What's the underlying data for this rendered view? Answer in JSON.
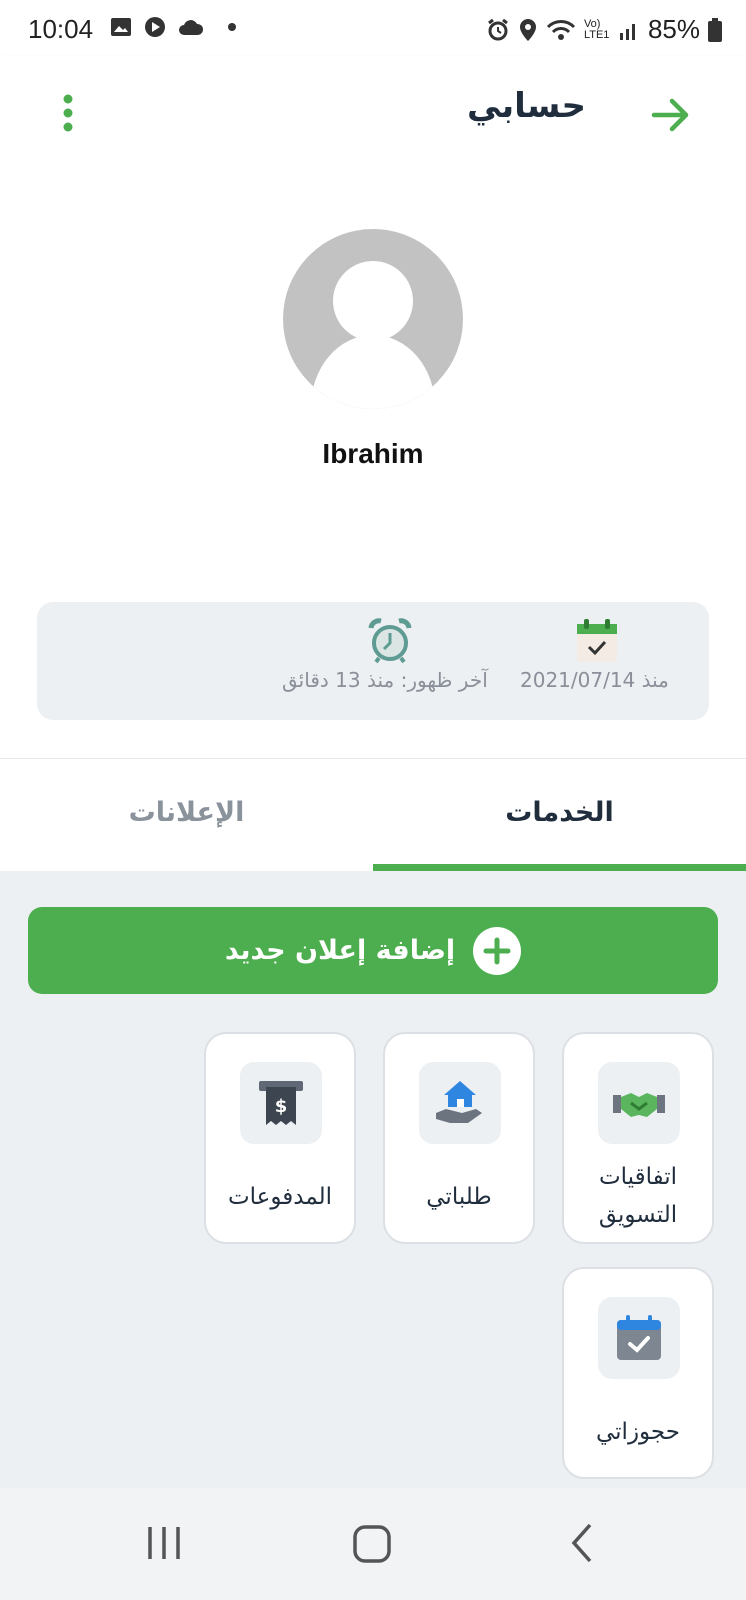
{
  "status_bar": {
    "time": "10:04",
    "battery": "85%",
    "network": "Vo) LTE1"
  },
  "app_bar": {
    "title": "حسابي",
    "back_icon": "arrow-right-icon",
    "menu_icon": "more-vertical-icon"
  },
  "profile": {
    "name": "Ibrahim",
    "member_since": "منذ 2021/07/14",
    "last_seen": "آخر ظهور: منذ 13 دقائق"
  },
  "tabs": [
    {
      "label": "الخدمات",
      "active": true
    },
    {
      "label": "الإعلانات",
      "active": false
    }
  ],
  "add_ad_button": "إضافة إعلان جديد",
  "services": [
    {
      "label": "اتفاقيات التسويق",
      "icon": "handshake-icon"
    },
    {
      "label": "طلباتي",
      "icon": "house-hand-icon"
    },
    {
      "label": "المدفوعات",
      "icon": "receipt-dollar-icon"
    },
    {
      "label": "حجوزاتي",
      "icon": "calendar-check-icon"
    }
  ],
  "colors": {
    "accent": "#4cae4f",
    "text_dark": "#1f2d3d",
    "muted": "#8a929c",
    "background": "#edf0f2"
  }
}
